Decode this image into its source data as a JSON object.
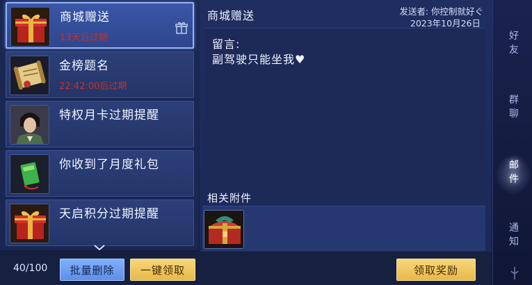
{
  "mail_list": [
    {
      "title": "商城赠送",
      "expire": "13天后过期",
      "thumb": "gift-box-icon",
      "badge": "gift-icon",
      "selected": true
    },
    {
      "title": "金榜题名",
      "expire": "22:42:00后过期",
      "thumb": "scroll-icon",
      "selected": false
    },
    {
      "title": "特权月卡过期提醒",
      "expire": "",
      "thumb": "character-portrait-icon",
      "selected": false
    },
    {
      "title": "你收到了月度礼包",
      "expire": "",
      "thumb": "green-pack-icon",
      "selected": false
    },
    {
      "title": "天启积分过期提醒",
      "expire": "",
      "thumb": "gift-box-icon",
      "selected": false
    }
  ],
  "footer": {
    "count": "40/100",
    "batch_delete": "批量删除",
    "claim_all": "一键领取",
    "claim_reward": "领取奖励"
  },
  "detail": {
    "title": "商城赠送",
    "sender": "发送者: 你控制就好ぐ",
    "date": "2023年10月26日",
    "message_label": "留言:",
    "message_text": "副驾驶只能坐我♥",
    "attachments_label": "相关附件",
    "attachment_icon": "treasure-chest-icon"
  },
  "tabs": [
    {
      "label": "好\n友",
      "active": false
    },
    {
      "label": "群\n聊",
      "active": false
    },
    {
      "label": "邮\n件",
      "active": true
    },
    {
      "label": "通\n知",
      "active": false
    }
  ],
  "colors": {
    "expire_red": "#c0342d",
    "gold_button": "#e8b94a",
    "blue_button": "#6f9ff2",
    "selected_border": "#8fb4ff"
  }
}
